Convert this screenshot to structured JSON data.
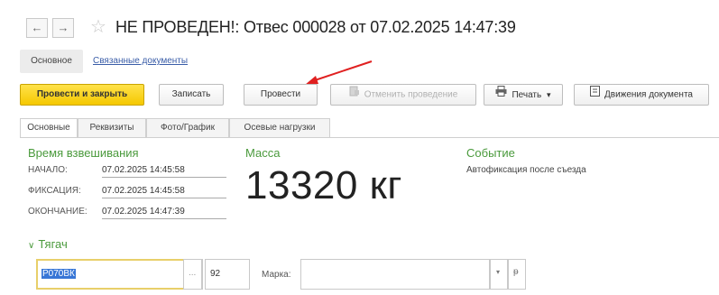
{
  "window": {
    "title": "НЕ ПРОВЕДЕН!: Отвес 000028 от 07.02.2025 14:47:39",
    "nav_back": "←",
    "nav_forward": "→",
    "favorite": "☆"
  },
  "section_tabs": [
    {
      "label": "Основное"
    },
    {
      "label": "Связанные документы"
    }
  ],
  "toolbar": {
    "post_close": "Провести и закрыть",
    "save": "Записать",
    "post": "Провести",
    "cancel_post": "Отменить проведение",
    "print": "Печать",
    "print_arrow": "▾",
    "movements": "Движения документа"
  },
  "content_tabs": [
    {
      "label": "Основные"
    },
    {
      "label": "Реквизиты"
    },
    {
      "label": "Фото/График"
    },
    {
      "label": "Осевые нагрузки"
    }
  ],
  "weighing": {
    "header": "Время взвешивания",
    "start_label": "НАЧАЛО:",
    "start_value": "07.02.2025 14:45:58",
    "fix_label": "ФИКСАЦИЯ:",
    "fix_value": "07.02.2025 14:45:58",
    "end_label": "ОКОНЧАНИЕ:",
    "end_value": "07.02.2025 14:47:39"
  },
  "mass": {
    "header": "Масса",
    "value": "13320 кг"
  },
  "event": {
    "header": "Событие",
    "text": "Автофиксация после съезда"
  },
  "tractor": {
    "header": "Тягач",
    "plate": "Р070ВК",
    "region": "92",
    "brand_label": "Марка:",
    "brand_value": ""
  },
  "colors": {
    "accent_green": "#4a9a3c",
    "primary_button": "#f5c800",
    "arrow_red": "#e02020",
    "link_blue": "#3a5da8"
  }
}
